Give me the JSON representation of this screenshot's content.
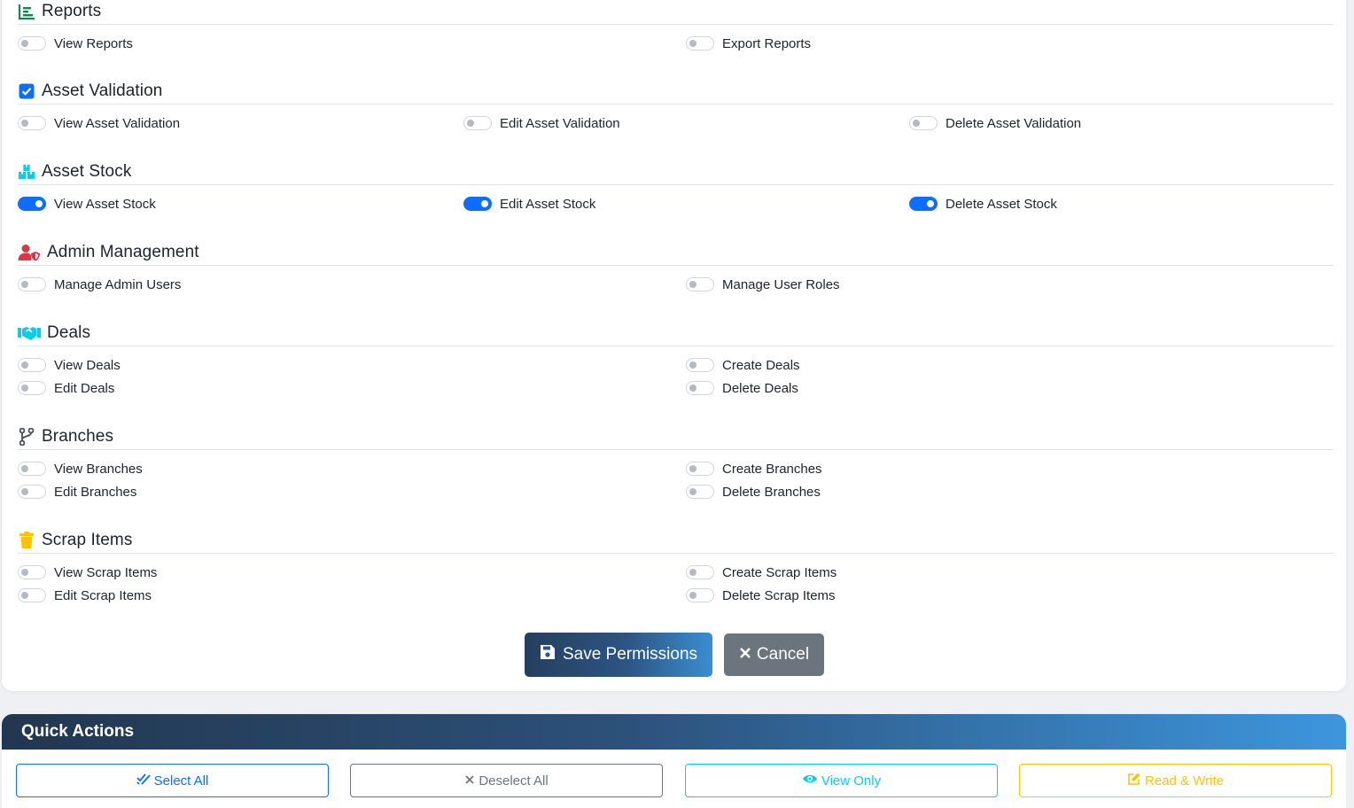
{
  "permissions": {
    "reports": {
      "title": "Reports",
      "icon": "chart-icon",
      "items": [
        {
          "label": "View Reports",
          "checked": false
        },
        {
          "label": "Export Reports",
          "checked": false
        }
      ]
    },
    "asset_validation": {
      "title": "Asset Validation",
      "icon": "check-square-icon",
      "items": [
        {
          "label": "View Asset Validation",
          "checked": false
        },
        {
          "label": "Edit Asset Validation",
          "checked": false
        },
        {
          "label": "Delete Asset Validation",
          "checked": false
        }
      ]
    },
    "asset_stock": {
      "title": "Asset Stock",
      "icon": "boxes-icon",
      "items": [
        {
          "label": "View Asset Stock",
          "checked": true
        },
        {
          "label": "Edit Asset Stock",
          "checked": true
        },
        {
          "label": "Delete Asset Stock",
          "checked": true
        }
      ]
    },
    "admin_management": {
      "title": "Admin Management",
      "icon": "user-shield-icon",
      "items": [
        {
          "label": "Manage Admin Users",
          "checked": false
        },
        {
          "label": "Manage User Roles",
          "checked": false
        }
      ]
    },
    "deals": {
      "title": "Deals",
      "icon": "handshake-icon",
      "items": [
        {
          "label": "View Deals",
          "checked": false
        },
        {
          "label": "Create Deals",
          "checked": false
        },
        {
          "label": "Edit Deals",
          "checked": false
        },
        {
          "label": "Delete Deals",
          "checked": false
        }
      ]
    },
    "branches": {
      "title": "Branches",
      "icon": "code-branch-icon",
      "items": [
        {
          "label": "View Branches",
          "checked": false
        },
        {
          "label": "Create Branches",
          "checked": false
        },
        {
          "label": "Edit Branches",
          "checked": false
        },
        {
          "label": "Delete Branches",
          "checked": false
        }
      ]
    },
    "scrap_items": {
      "title": "Scrap Items",
      "icon": "trash-icon",
      "items": [
        {
          "label": "View Scrap Items",
          "checked": false
        },
        {
          "label": "Create Scrap Items",
          "checked": false
        },
        {
          "label": "Edit Scrap Items",
          "checked": false
        },
        {
          "label": "Delete Scrap Items",
          "checked": false
        }
      ]
    }
  },
  "actions": {
    "save_label": "Save Permissions",
    "cancel_label": "Cancel"
  },
  "quick_actions": {
    "title": "Quick Actions",
    "select_all": "Select All",
    "deselect_all": "Deselect All",
    "view_only": "View Only",
    "read_write": "Read & Write"
  },
  "colors": {
    "primary": "#0d6efd",
    "secondary": "#6c757d",
    "info": "#0dcaf0",
    "warning": "#ffc107",
    "danger": "#dc3545"
  }
}
